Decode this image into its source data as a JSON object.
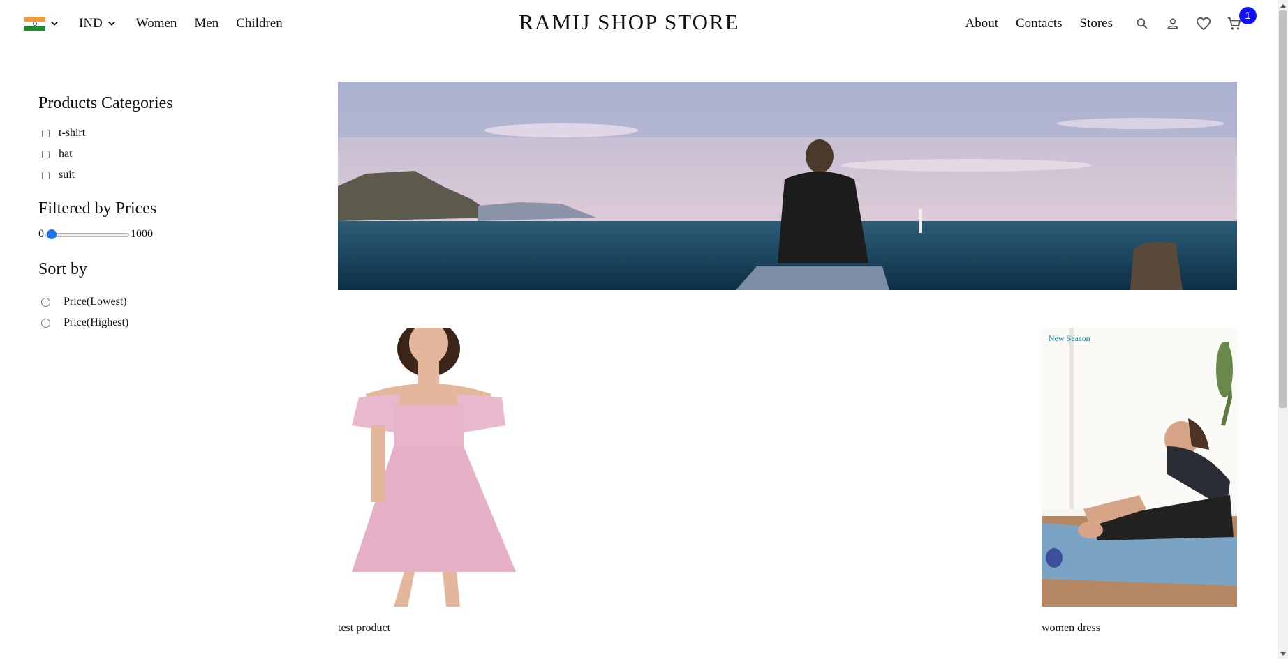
{
  "nav": {
    "country_icon": "india-flag-icon",
    "currency": "IND",
    "links_left": [
      "Women",
      "Men",
      "Children"
    ],
    "brand": "RAMIJ SHOP STORE",
    "links_right": [
      "About",
      "Contacts",
      "Stores"
    ],
    "icons": [
      "search-icon",
      "user-icon",
      "heart-icon",
      "cart-icon"
    ],
    "cart_count": "1"
  },
  "sidebar": {
    "categories_title": "Products Categories",
    "categories": [
      "t-shirt",
      "hat",
      "suit"
    ],
    "price_title": "Filtered by Prices",
    "price_min": "0",
    "price_max": "1000",
    "price_value": 0,
    "sort_title": "Sort by",
    "sort_options": [
      "Price(Lowest)",
      "Price(Highest)"
    ]
  },
  "hero": {
    "image": "man-sitting-by-sea-photo"
  },
  "products": [
    {
      "name": "test product",
      "image": "woman-pink-dress-photo",
      "badge": ""
    },
    {
      "name": "women dress",
      "image": "woman-yoga-stretching-photo",
      "badge": "New Season"
    }
  ]
}
